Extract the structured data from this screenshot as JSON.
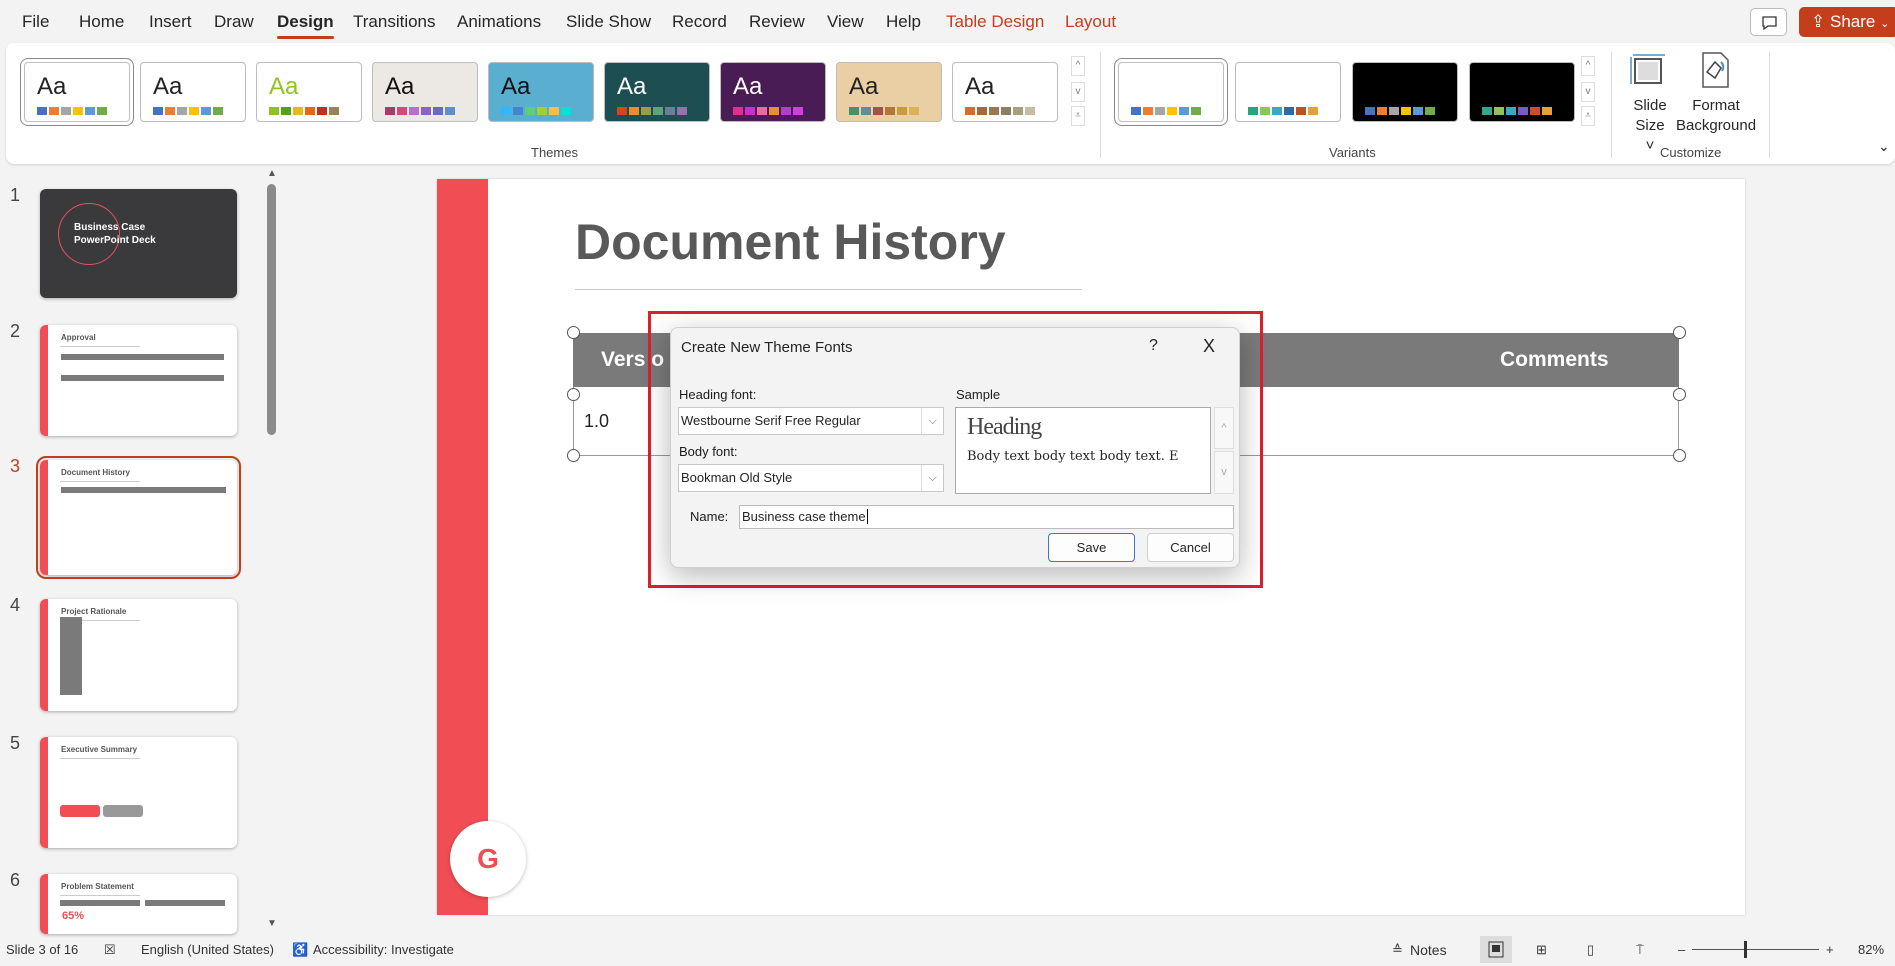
{
  "menu": {
    "tabs": [
      "File",
      "Home",
      "Insert",
      "Draw",
      "Design",
      "Transitions",
      "Animations",
      "Slide Show",
      "Record",
      "Review",
      "View",
      "Help"
    ],
    "active": "Design",
    "context_tabs": [
      "Table Design",
      "Layout"
    ],
    "share_label": "Share"
  },
  "ribbon": {
    "themes_label": "Themes",
    "variants_label": "Variants",
    "customize_label": "Customize",
    "slide_size_label": "Slide",
    "slide_size_label2": "Size",
    "format_bg_label": "Format",
    "format_bg_label2": "Background",
    "themes": [
      {
        "aa": "Aa",
        "bg": "#ffffff",
        "fg": "#222222",
        "sw": [
          "#4472c4",
          "#ed7d31",
          "#a5a5a5",
          "#ffc000",
          "#5b9bd5",
          "#70ad47"
        ]
      },
      {
        "aa": "Aa",
        "bg": "#ffffff",
        "fg": "#222222",
        "sw": [
          "#4472c4",
          "#ed7d31",
          "#a5a5a5",
          "#ffc000",
          "#5b9bd5",
          "#70ad47"
        ]
      },
      {
        "aa": "Aa",
        "bg": "#ffffff",
        "fg": "#90c226",
        "sw": [
          "#90c226",
          "#54a021",
          "#e6b91e",
          "#e76618",
          "#c42f1a",
          "#918655"
        ]
      },
      {
        "aa": "Aa",
        "bg": "#ece8e4",
        "fg": "#111111",
        "sw": [
          "#a53d6b",
          "#d04a7e",
          "#b670d0",
          "#8a63c7",
          "#6b6bbf",
          "#5f8ed0"
        ]
      },
      {
        "aa": "Aa",
        "bg": "#5aaed0",
        "fg": "#111111",
        "sw": [
          "#31b6fd",
          "#4584d3",
          "#5bd078",
          "#a5d028",
          "#f5c040",
          "#05e0db"
        ]
      },
      {
        "aa": "Aa",
        "bg": "#1d4f52",
        "fg": "#ffffff",
        "sw": [
          "#d34817",
          "#ee8c2c",
          "#9b9b4c",
          "#5fa37c",
          "#6d7e9a",
          "#9c6eaa"
        ]
      },
      {
        "aa": "Aa",
        "bg": "#4a1c55",
        "fg": "#ffffff",
        "sw": [
          "#e32d91",
          "#c830cc",
          "#ea6ba4",
          "#f08b34",
          "#b63bd6",
          "#d33ee0"
        ]
      },
      {
        "aa": "Aa",
        "bg": "#e9cfa3",
        "fg": "#222222",
        "sw": [
          "#4e8d72",
          "#5b8fa0",
          "#a74e4e",
          "#b5763a",
          "#c89c3b",
          "#d9b25a"
        ]
      },
      {
        "aa": "Aa",
        "bg": "#ffffff",
        "fg": "#222222",
        "sw": [
          "#d36f26",
          "#a8682f",
          "#9b7752",
          "#8c7e66",
          "#a89f7c",
          "#c5bda1"
        ]
      }
    ],
    "variants": [
      {
        "bg": "#ffffff",
        "sw": [
          "#4472c4",
          "#ed7d31",
          "#a5a5a5",
          "#ffc000",
          "#5b9bd5",
          "#70ad47"
        ]
      },
      {
        "bg": "#ffffff",
        "sw": [
          "#29a37a",
          "#8fc45a",
          "#36a9c7",
          "#2b6ca8",
          "#b9542a",
          "#e2a23b"
        ]
      },
      {
        "bg": "#000000",
        "sw": [
          "#4472c4",
          "#ed7d31",
          "#a5a5a5",
          "#ffc000",
          "#5b9bd5",
          "#70ad47"
        ]
      },
      {
        "bg": "#000000",
        "sw": [
          "#2fa88c",
          "#8fc45a",
          "#36a9c7",
          "#7b5ac4",
          "#d04a30",
          "#e2a23b"
        ]
      }
    ]
  },
  "slides_panel": {
    "slides": [
      {
        "n": "1",
        "title": "Business Case PowerPoint Deck"
      },
      {
        "n": "2",
        "title": "Approval"
      },
      {
        "n": "3",
        "title": "Document History"
      },
      {
        "n": "4",
        "title": "Project Rationale"
      },
      {
        "n": "5",
        "title": "Executive Summary"
      },
      {
        "n": "6",
        "title": "Problem Statement",
        "stat": "65%"
      }
    ],
    "selected": "3"
  },
  "slide": {
    "title": "Document History",
    "table_headers": [
      "Vers o",
      "Comments"
    ],
    "row": [
      "1.0"
    ],
    "logo": "G",
    "accent": "#f04e54"
  },
  "dialog": {
    "title": "Create New Theme Fonts",
    "help": "?",
    "close": "X",
    "heading_label": "Heading font:",
    "heading_value": "Westbourne Serif Free Regular",
    "body_label": "Body font:",
    "body_value": "Bookman Old Style",
    "sample_label": "Sample",
    "sample_heading": "Heading",
    "sample_body": "Body text body text body text. E",
    "name_label": "Name:",
    "name_value": "Business case theme",
    "save": "Save",
    "cancel": "Cancel"
  },
  "status": {
    "slide": "Slide 3 of 16",
    "language": "English (United States)",
    "accessibility": "Accessibility: Investigate",
    "notes": "Notes",
    "zoom": "82%",
    "zoom_level": 82
  }
}
